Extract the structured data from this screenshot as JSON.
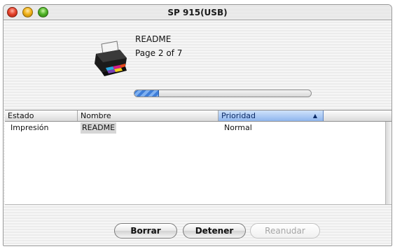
{
  "window": {
    "title": "SP 915(USB)"
  },
  "job": {
    "document_name": "README",
    "page_status": "Page 2 of 7",
    "progress_fraction": 0.14
  },
  "table": {
    "columns": [
      "Estado",
      "Nombre",
      "Prioridad"
    ],
    "sorted_column": "Prioridad",
    "rows": [
      {
        "estado": "Impresión",
        "nombre": "README",
        "prioridad": "Normal"
      }
    ]
  },
  "buttons": {
    "borrar": "Borrar",
    "detener": "Detener",
    "reanudar": "Reanudar"
  },
  "icons": {
    "printer": "printer-icon",
    "sort": "sort-ascending-icon"
  },
  "colors": {
    "progress_fill": "#3f7ed8",
    "sorted_header": "#8fb6ee",
    "close_light": "#e6452f",
    "minimize_light": "#f2b41c",
    "zoom_light": "#52b62a"
  }
}
